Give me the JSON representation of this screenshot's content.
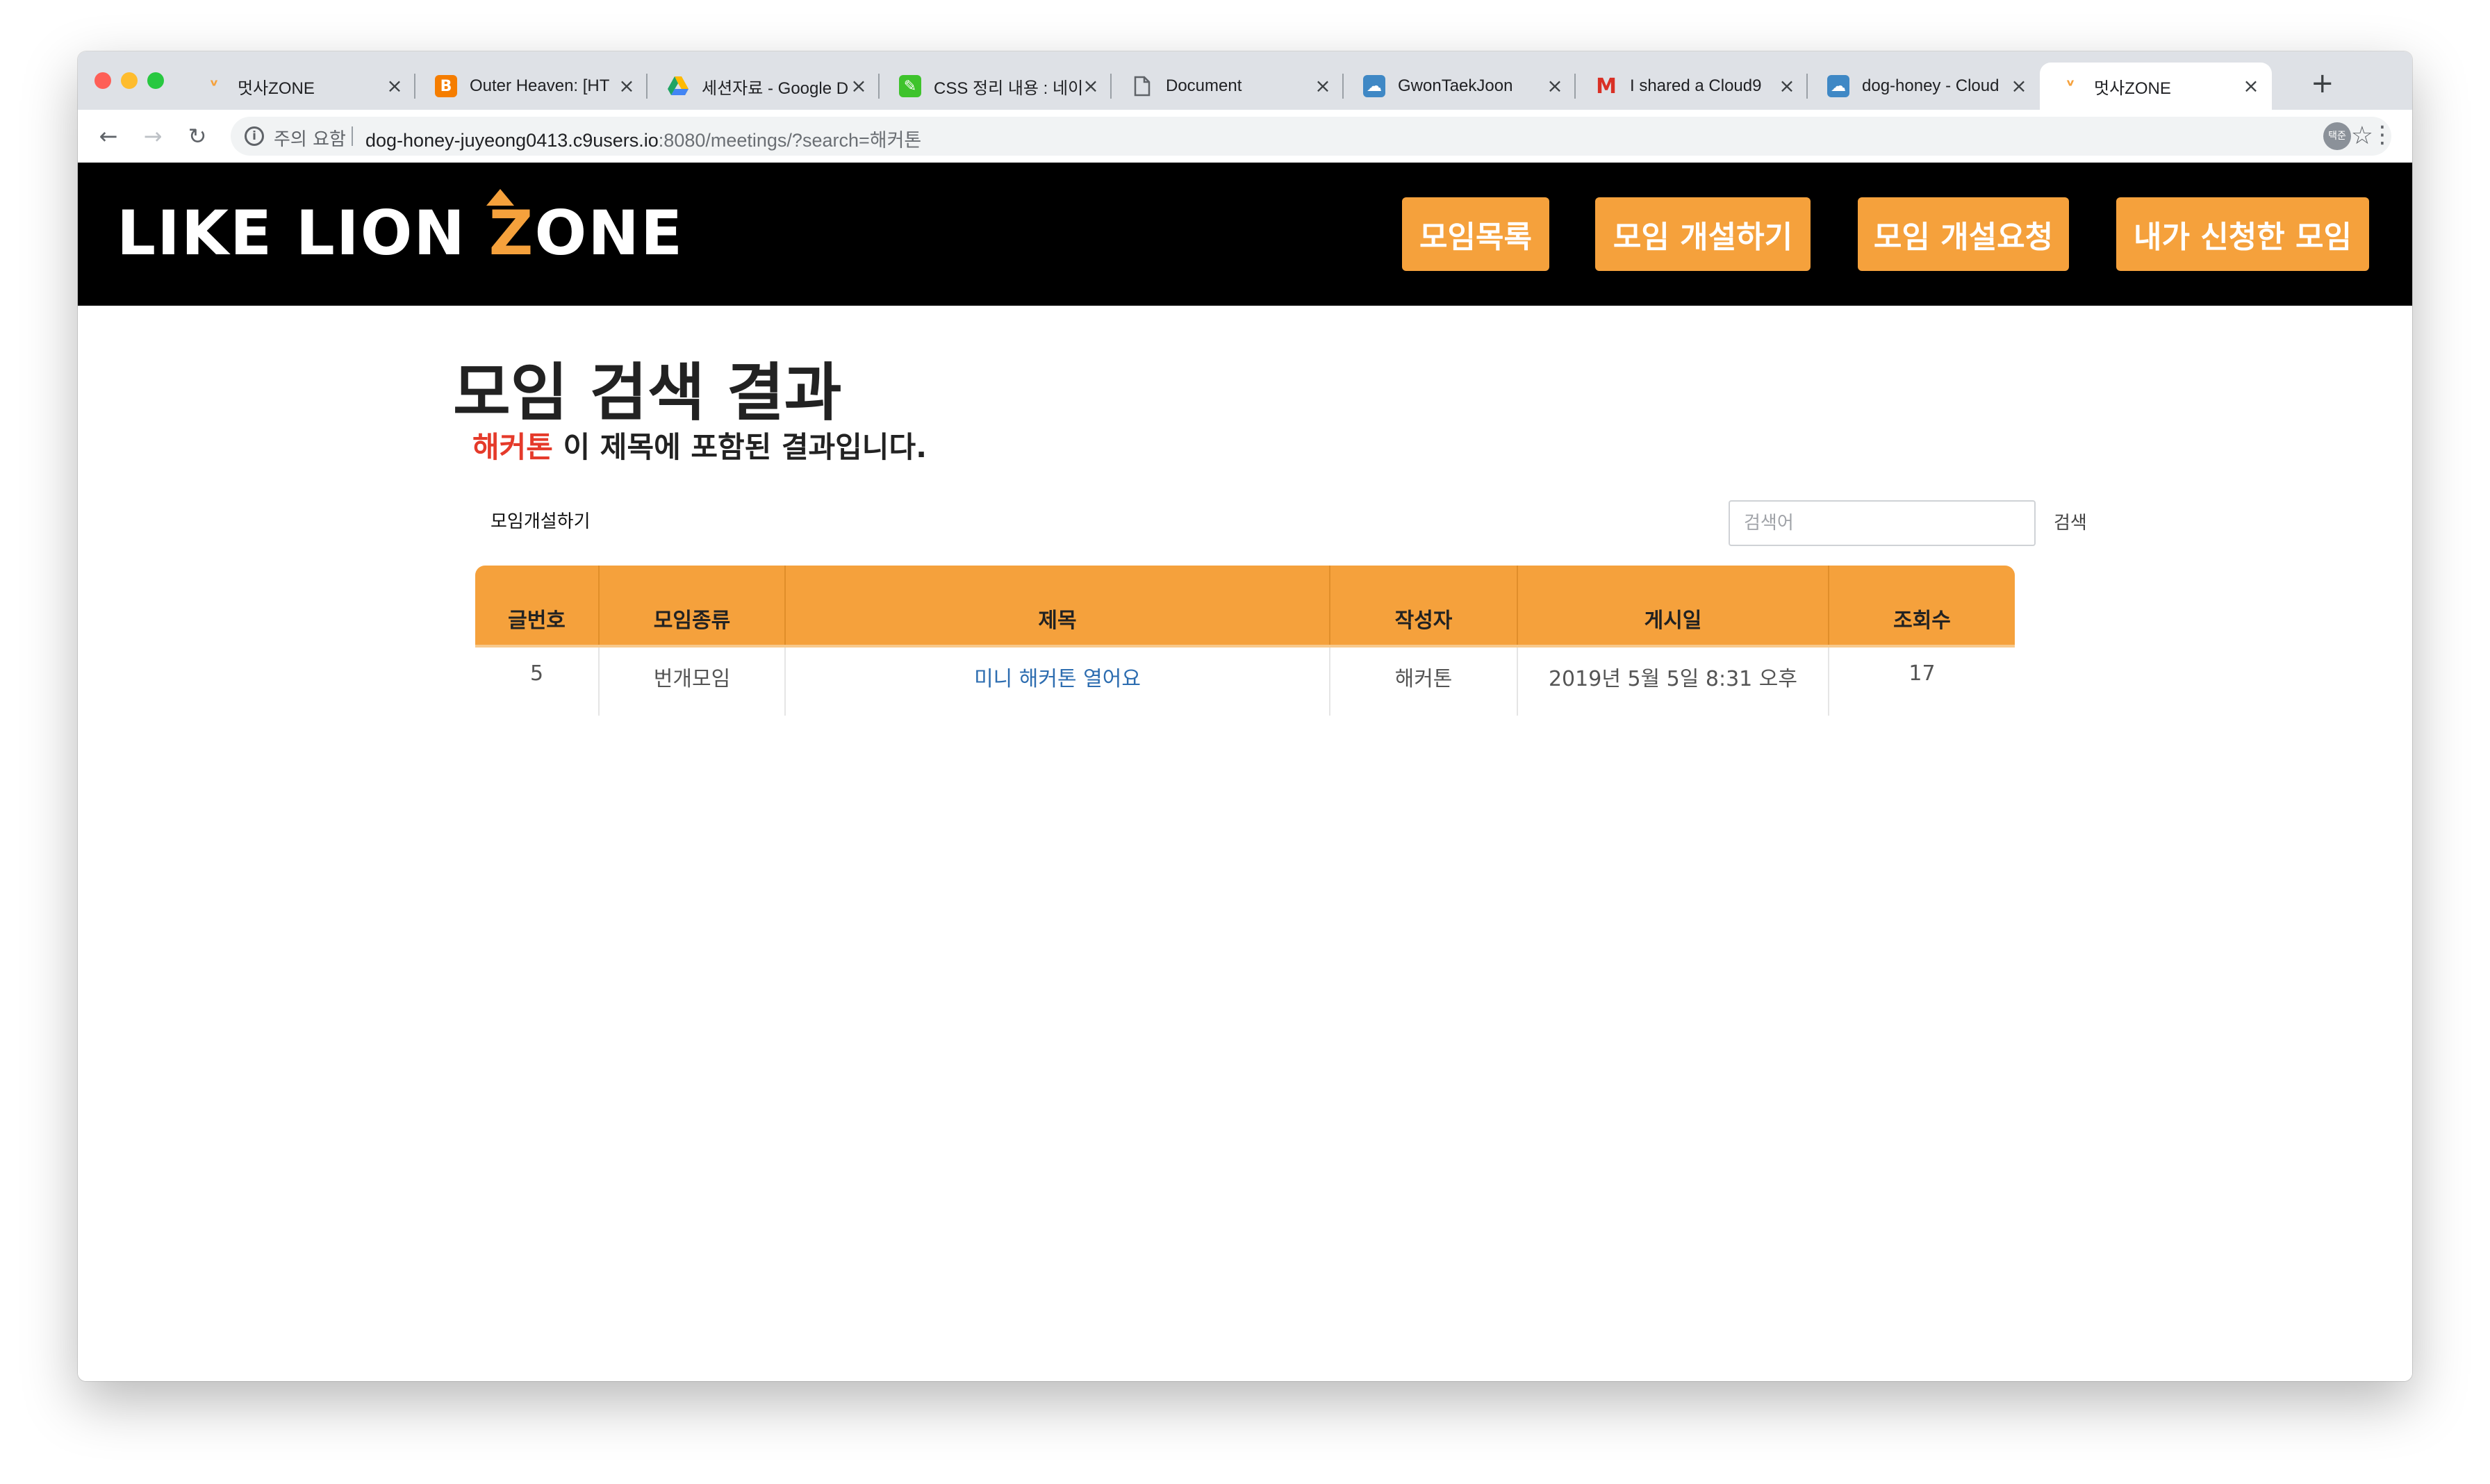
{
  "browser": {
    "tabs": [
      {
        "title": "멋사ZONE",
        "favicon": "lion-favicon",
        "color": "#f5a13c"
      },
      {
        "title": "Outer Heaven: [HT",
        "favicon": "blogger-favicon",
        "color": "#f57d00"
      },
      {
        "title": "세션자료 - Google D",
        "favicon": "google-drive-favicon",
        "color": "#1fa463"
      },
      {
        "title": "CSS 정리 내용 : 네이",
        "favicon": "note-favicon",
        "color": "#3ec32c"
      },
      {
        "title": "Document",
        "favicon": "document-favicon",
        "color": "#5f6368"
      },
      {
        "title": "GwonTaekJoon",
        "favicon": "cloud9-favicon",
        "color": "#3f88c5"
      },
      {
        "title": "I shared a Cloud9",
        "favicon": "gmail-favicon",
        "color": "#d93025"
      },
      {
        "title": "dog-honey - Cloud",
        "favicon": "cloud9-favicon",
        "color": "#3f88c5"
      },
      {
        "title": "멋사ZONE",
        "favicon": "lion-favicon",
        "color": "#f5a13c",
        "active": true
      }
    ],
    "security_label": "주의 요함",
    "url_host": "dog-honey-juyeong0413.c9users.io",
    "url_rest": ":8080/meetings/?search=해커톤",
    "profile_initials": "택준"
  },
  "header": {
    "logo": {
      "part1": "LIKE LION",
      "z": "Z",
      "part2": "ONE"
    },
    "nav": [
      "모임목록",
      "모임 개설하기",
      "모임 개설요청",
      "내가 신청한 모임"
    ]
  },
  "main": {
    "title": "모임 검색 결과",
    "keyword": "해커톤",
    "subtitle_suffix": " 이 제목에 포함된 결과입니다.",
    "create_link": "모임개설하기",
    "search_placeholder": "검색어",
    "search_button": "검색"
  },
  "table": {
    "headers": [
      "글번호",
      "모임종류",
      "제목",
      "작성자",
      "게시일",
      "조회수"
    ],
    "rows": [
      {
        "no": "5",
        "type": "번개모임",
        "title": "미니 해커톤 열어요",
        "author": "해커톤",
        "date": "2019년 5월 5일 8:31 오후",
        "views": "17"
      }
    ]
  },
  "colors": {
    "accent": "#f5a13c",
    "keyword": "#e53a2a",
    "link": "#2d6db0",
    "header_bg": "#000000"
  }
}
